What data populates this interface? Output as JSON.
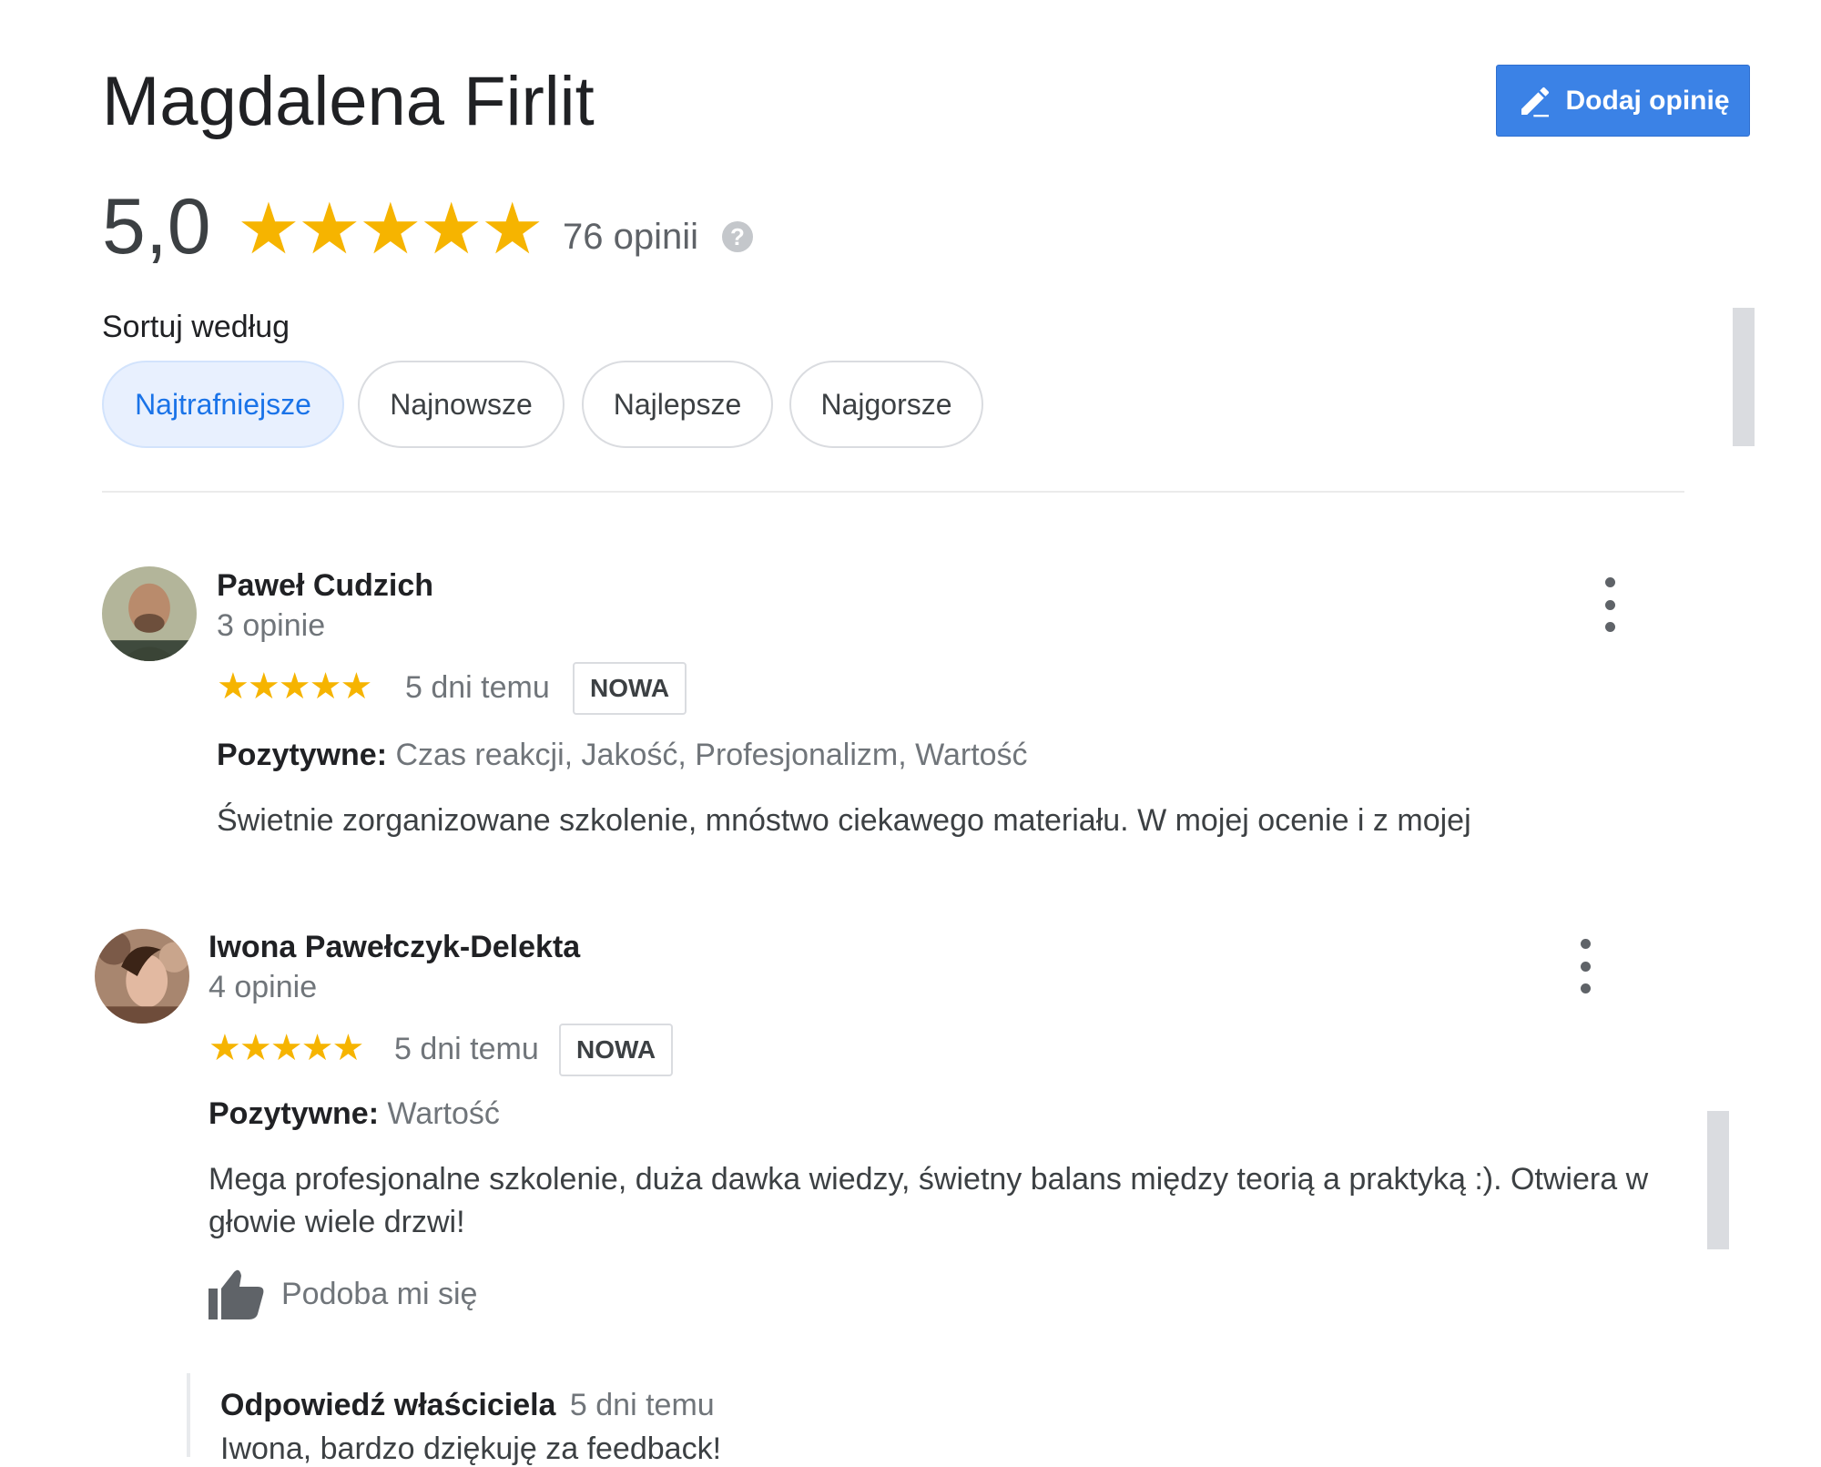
{
  "header": {
    "title": "Magdalena Firlit",
    "add_review_label": "Dodaj opinię",
    "rating": "5,0",
    "stars": "★★★★★",
    "review_count": "76 opinii",
    "help_glyph": "?"
  },
  "sort": {
    "label": "Sortuj według",
    "options": [
      "Najtrafniejsze",
      "Najnowsze",
      "Najlepsze",
      "Najgorsze"
    ],
    "selected": "Najtrafniejsze"
  },
  "reviews": [
    {
      "author": "Paweł Cudzich",
      "author_reviews": "3 opinie",
      "stars": "★★★★★",
      "rating": 5,
      "time": "5 dni temu",
      "badge": "NOWA",
      "positive_label": "Pozytywne:",
      "positive_values": "Czas reakcji, Jakość, Profesjonalizm, Wartość",
      "text": "Świetnie zorganizowane szkolenie, mnóstwo ciekawego materiału. W mojej ocenie i z mojej"
    },
    {
      "author": "Iwona Pawełczyk-Delekta",
      "author_reviews": "4 opinie",
      "stars": "★★★★★",
      "rating": 5,
      "time": "5 dni temu",
      "badge": "NOWA",
      "positive_label": "Pozytywne:",
      "positive_values": "Wartość",
      "text": "Mega profesjonalne szkolenie, duża dawka wiedzy, świetny balans między teorią a praktyką :). Otwiera w głowie wiele drzwi!",
      "like_label": "Podoba mi się",
      "owner_reply": {
        "label": "Odpowiedź właściciela",
        "time": "5 dni temu",
        "text": "Iwona, bardzo dziękuję za feedback!"
      }
    }
  ],
  "colors": {
    "accent": "#3b82e6",
    "star": "#f6b400",
    "chip_active_bg": "#e8f0fe",
    "chip_active_text": "#1a73e8"
  },
  "icons": [
    "pencil-icon",
    "help-icon",
    "more-vert-icon",
    "thumb-up-icon"
  ]
}
